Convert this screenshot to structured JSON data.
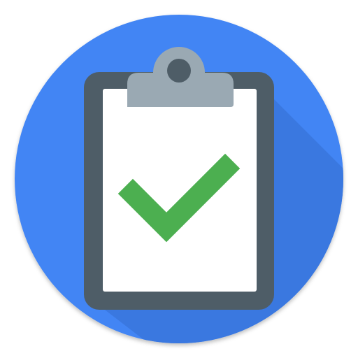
{
  "icon": {
    "name": "clipboard-check-icon",
    "colors": {
      "background_circle": "#4285F4",
      "long_shadow": "#3A78E0",
      "clipboard_frame": "#4E5D67",
      "paper": "#FFFFFF",
      "clip": "#9AA9B3",
      "checkmark": "#4CAF50"
    }
  }
}
